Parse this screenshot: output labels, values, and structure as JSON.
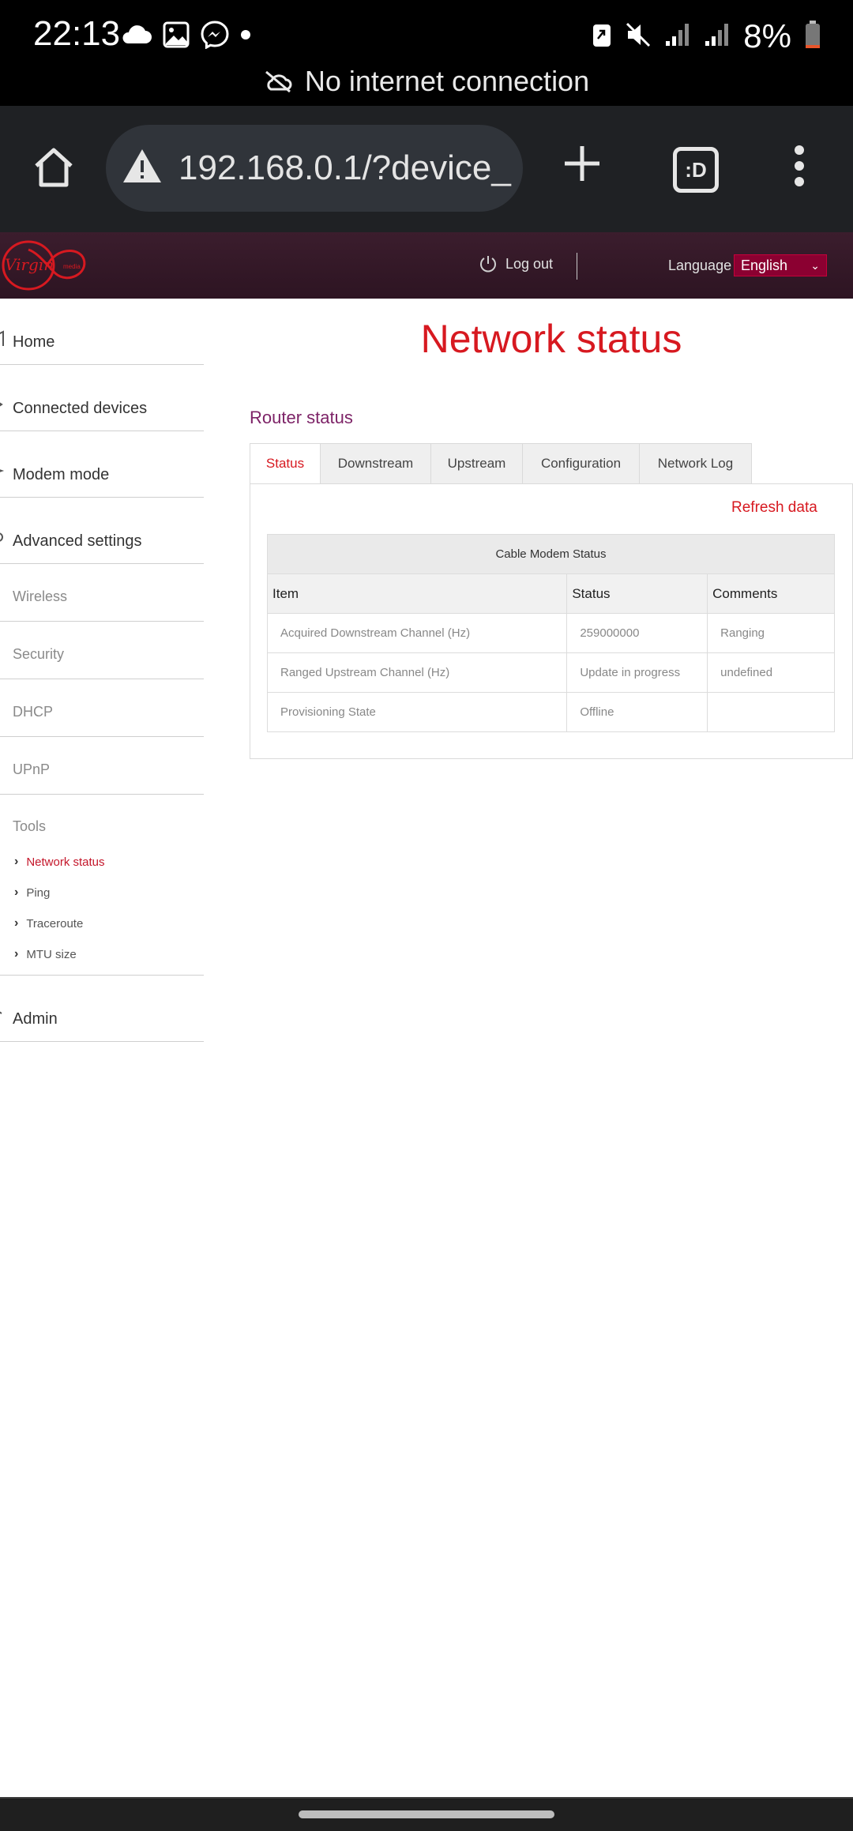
{
  "status_bar": {
    "time": "22:13",
    "battery": "8%",
    "notice": "No internet connection"
  },
  "browser": {
    "url": "192.168.0.1/?device_",
    "tab_switcher_label": ":D"
  },
  "router_header": {
    "logout_label": "Log out",
    "language_label": "Language",
    "language_value": "English",
    "brand_color": "#d71920"
  },
  "sidebar": {
    "main_items": [
      "Home",
      "Connected devices",
      "Modem mode",
      "Advanced settings"
    ],
    "advanced_subitems": [
      "Wireless",
      "Security",
      "DHCP",
      "UPnP"
    ],
    "tools": {
      "label": "Tools",
      "items": [
        "Network status",
        "Ping",
        "Traceroute",
        "MTU size"
      ],
      "active": "Network status"
    },
    "admin_label": "Admin"
  },
  "main": {
    "page_title": "Network status",
    "section_title": "Router status",
    "tabs": [
      "Status",
      "Downstream",
      "Upstream",
      "Configuration",
      "Network Log"
    ],
    "active_tab": "Status",
    "refresh_label": "Refresh data",
    "table": {
      "caption": "Cable Modem Status",
      "headers": [
        "Item",
        "Status",
        "Comments"
      ],
      "rows": [
        [
          "Acquired Downstream Channel (Hz)",
          "259000000",
          "Ranging"
        ],
        [
          "Ranged Upstream Channel (Hz)",
          "Update in progress",
          "undefined"
        ],
        [
          "Provisioning State",
          "Offline",
          ""
        ]
      ]
    }
  }
}
